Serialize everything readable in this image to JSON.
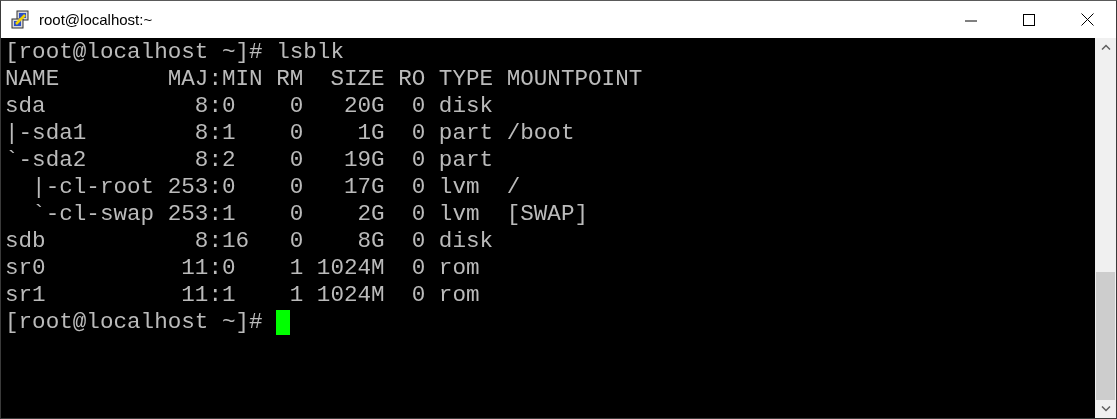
{
  "window": {
    "title": "root@localhost:~"
  },
  "terminal": {
    "lines": [
      "[root@localhost ~]# lsblk",
      "NAME        MAJ:MIN RM  SIZE RO TYPE MOUNTPOINT",
      "sda           8:0    0   20G  0 disk",
      "|-sda1        8:1    0    1G  0 part /boot",
      "`-sda2        8:2    0   19G  0 part",
      "  |-cl-root 253:0    0   17G  0 lvm  /",
      "  `-cl-swap 253:1    0    2G  0 lvm  [SWAP]",
      "sdb           8:16   0    8G  0 disk",
      "sr0          11:0    1 1024M  0 rom",
      "sr1          11:1    1 1024M  0 rom"
    ],
    "prompt": "[root@localhost ~]#"
  }
}
